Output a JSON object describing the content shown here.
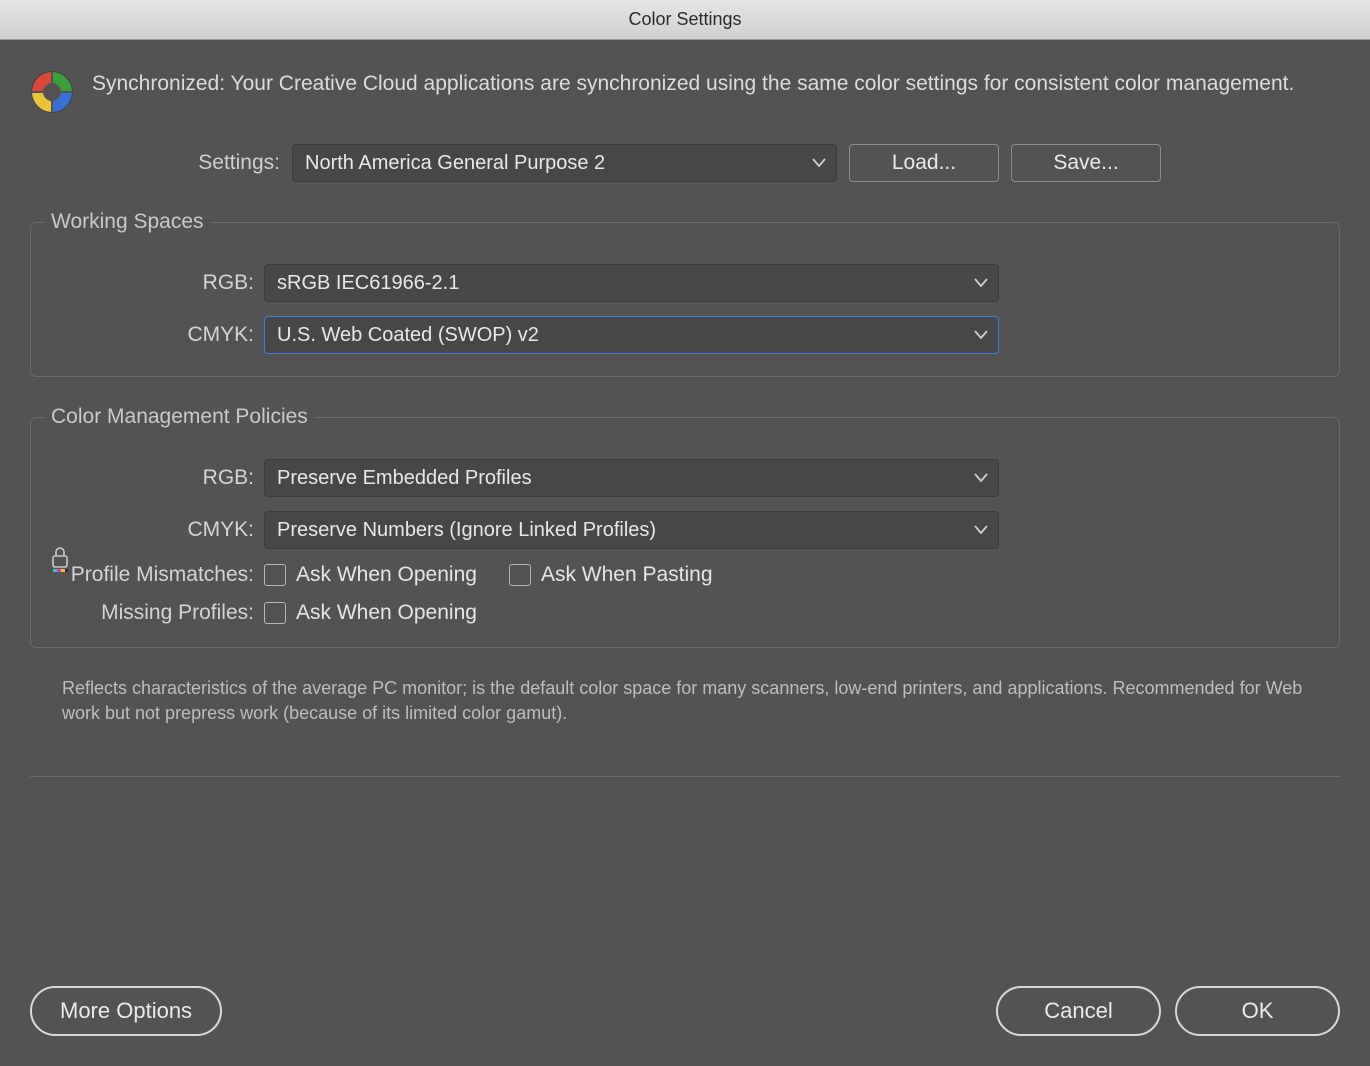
{
  "window": {
    "title": "Color Settings"
  },
  "header": {
    "sync_text": "Synchronized: Your Creative Cloud applications are synchronized using the same color settings for consistent color management."
  },
  "settings": {
    "label": "Settings:",
    "value": "North America General Purpose 2",
    "load_label": "Load...",
    "save_label": "Save..."
  },
  "working_spaces": {
    "legend": "Working Spaces",
    "rgb_label": "RGB:",
    "rgb_value": "sRGB IEC61966-2.1",
    "cmyk_label": "CMYK:",
    "cmyk_value": "U.S. Web Coated (SWOP) v2"
  },
  "policies": {
    "legend": "Color Management Policies",
    "rgb_label": "RGB:",
    "rgb_value": "Preserve Embedded Profiles",
    "cmyk_label": "CMYK:",
    "cmyk_value": "Preserve Numbers (Ignore Linked Profiles)",
    "profile_mismatches_label": "Profile Mismatches:",
    "ask_when_opening": "Ask When Opening",
    "ask_when_pasting": "Ask When Pasting",
    "missing_profiles_label": "Missing Profiles:"
  },
  "description": "Reflects characteristics of the average PC monitor; is the default color space for many scanners, low-end printers, and applications. Recommended for Web work but not prepress work (because of its limited color gamut).",
  "footer": {
    "more_options": "More Options",
    "cancel": "Cancel",
    "ok": "OK"
  }
}
